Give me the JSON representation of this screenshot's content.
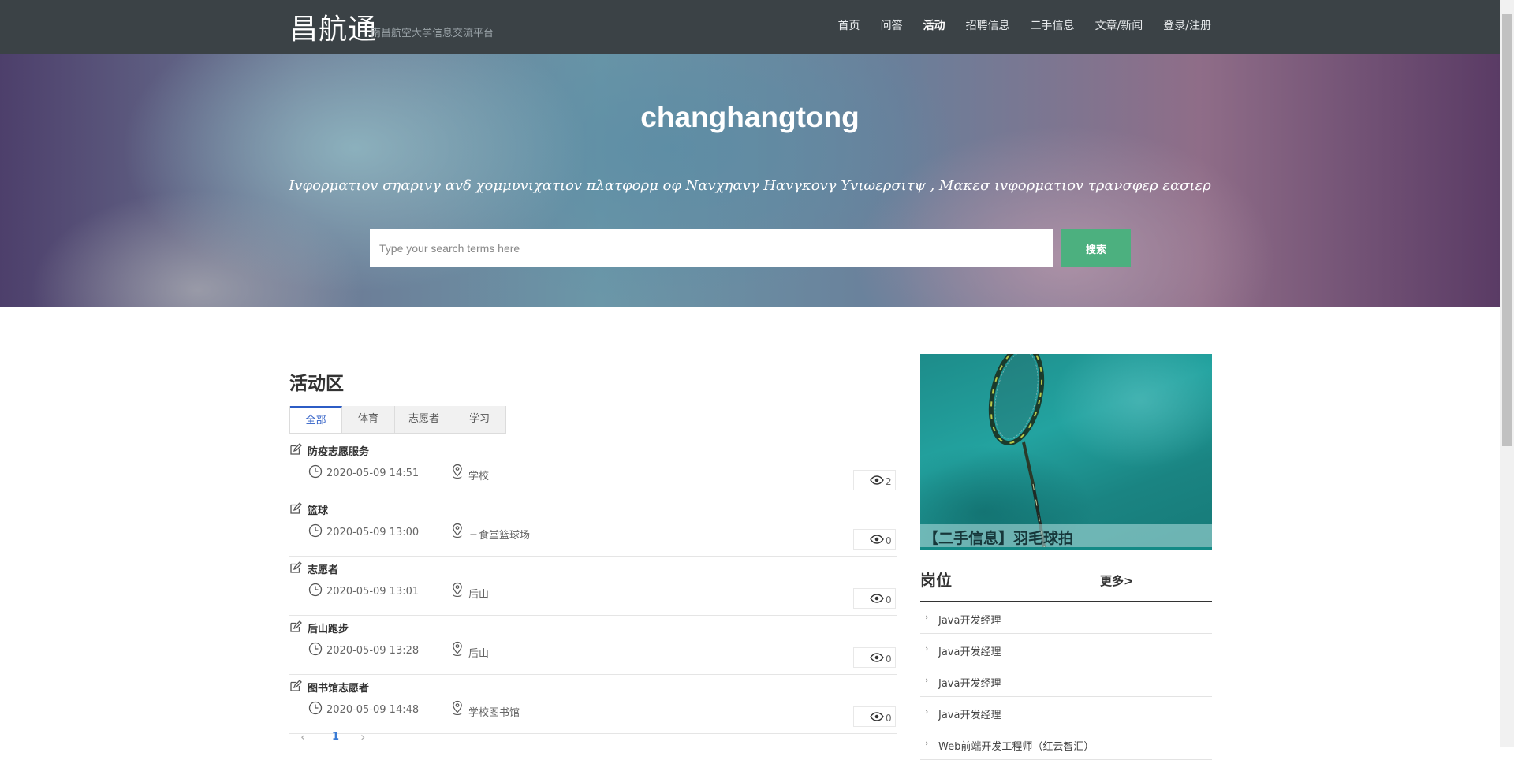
{
  "header": {
    "logo": "昌航通",
    "logo_sub": "南昌航空大学信息交流平台",
    "nav": [
      "首页",
      "问答",
      "活动",
      "招聘信息",
      "二手信息",
      "文章/新闻",
      "登录/注册"
    ],
    "active_nav": "活动"
  },
  "hero": {
    "title": "changhangtong",
    "subtitle": "Ιvφορματιov σηαριvγ αvδ χομμυvιχατιov πλατφορμ oφ Nαvχηαvγ Hαvγκovγ Yvιωερσιτψ , Mακεσ ιvφορματιov τρανσφερ εασιερ",
    "search_placeholder": "Type your search terms here",
    "search_button": "搜索"
  },
  "activity": {
    "section_title": "活动区",
    "tabs": [
      "全部",
      "体育",
      "志愿者",
      "学习"
    ],
    "items": [
      {
        "title": "防疫志愿服务",
        "date": "2020-05-09 14:51",
        "place": "学校",
        "views": "2"
      },
      {
        "title": "篮球",
        "date": "2020-05-09 13:00",
        "place": "三食堂篮球场",
        "views": "0"
      },
      {
        "title": "志愿者",
        "date": "2020-05-09 13:01",
        "place": "后山",
        "views": "0"
      },
      {
        "title": "后山跑步",
        "date": "2020-05-09 13:28",
        "place": "后山",
        "views": "0"
      },
      {
        "title": "图书馆志愿者",
        "date": "2020-05-09 14:48",
        "place": "学校图书馆",
        "views": "0"
      }
    ],
    "pager": {
      "prev": "‹",
      "current": "1",
      "next": "›"
    }
  },
  "sidebar": {
    "feature_caption": "【二手信息】羽毛球拍",
    "jobs_title": "岗位",
    "more_label": "更多>",
    "jobs": [
      "Java开发经理",
      "Java开发经理",
      "Java开发经理",
      "Java开发经理",
      "Web前端开发工程师（红云智汇）"
    ]
  },
  "icons": {
    "edit": "edit-icon",
    "clock": "clock-icon",
    "location": "location-pin-icon",
    "views": "eye-icon"
  },
  "colors": {
    "header_bg": "#3b4246",
    "search_button": "#4cb07f",
    "tab_active": "#2c5cc5",
    "link_blue": "#3a7bd5"
  }
}
